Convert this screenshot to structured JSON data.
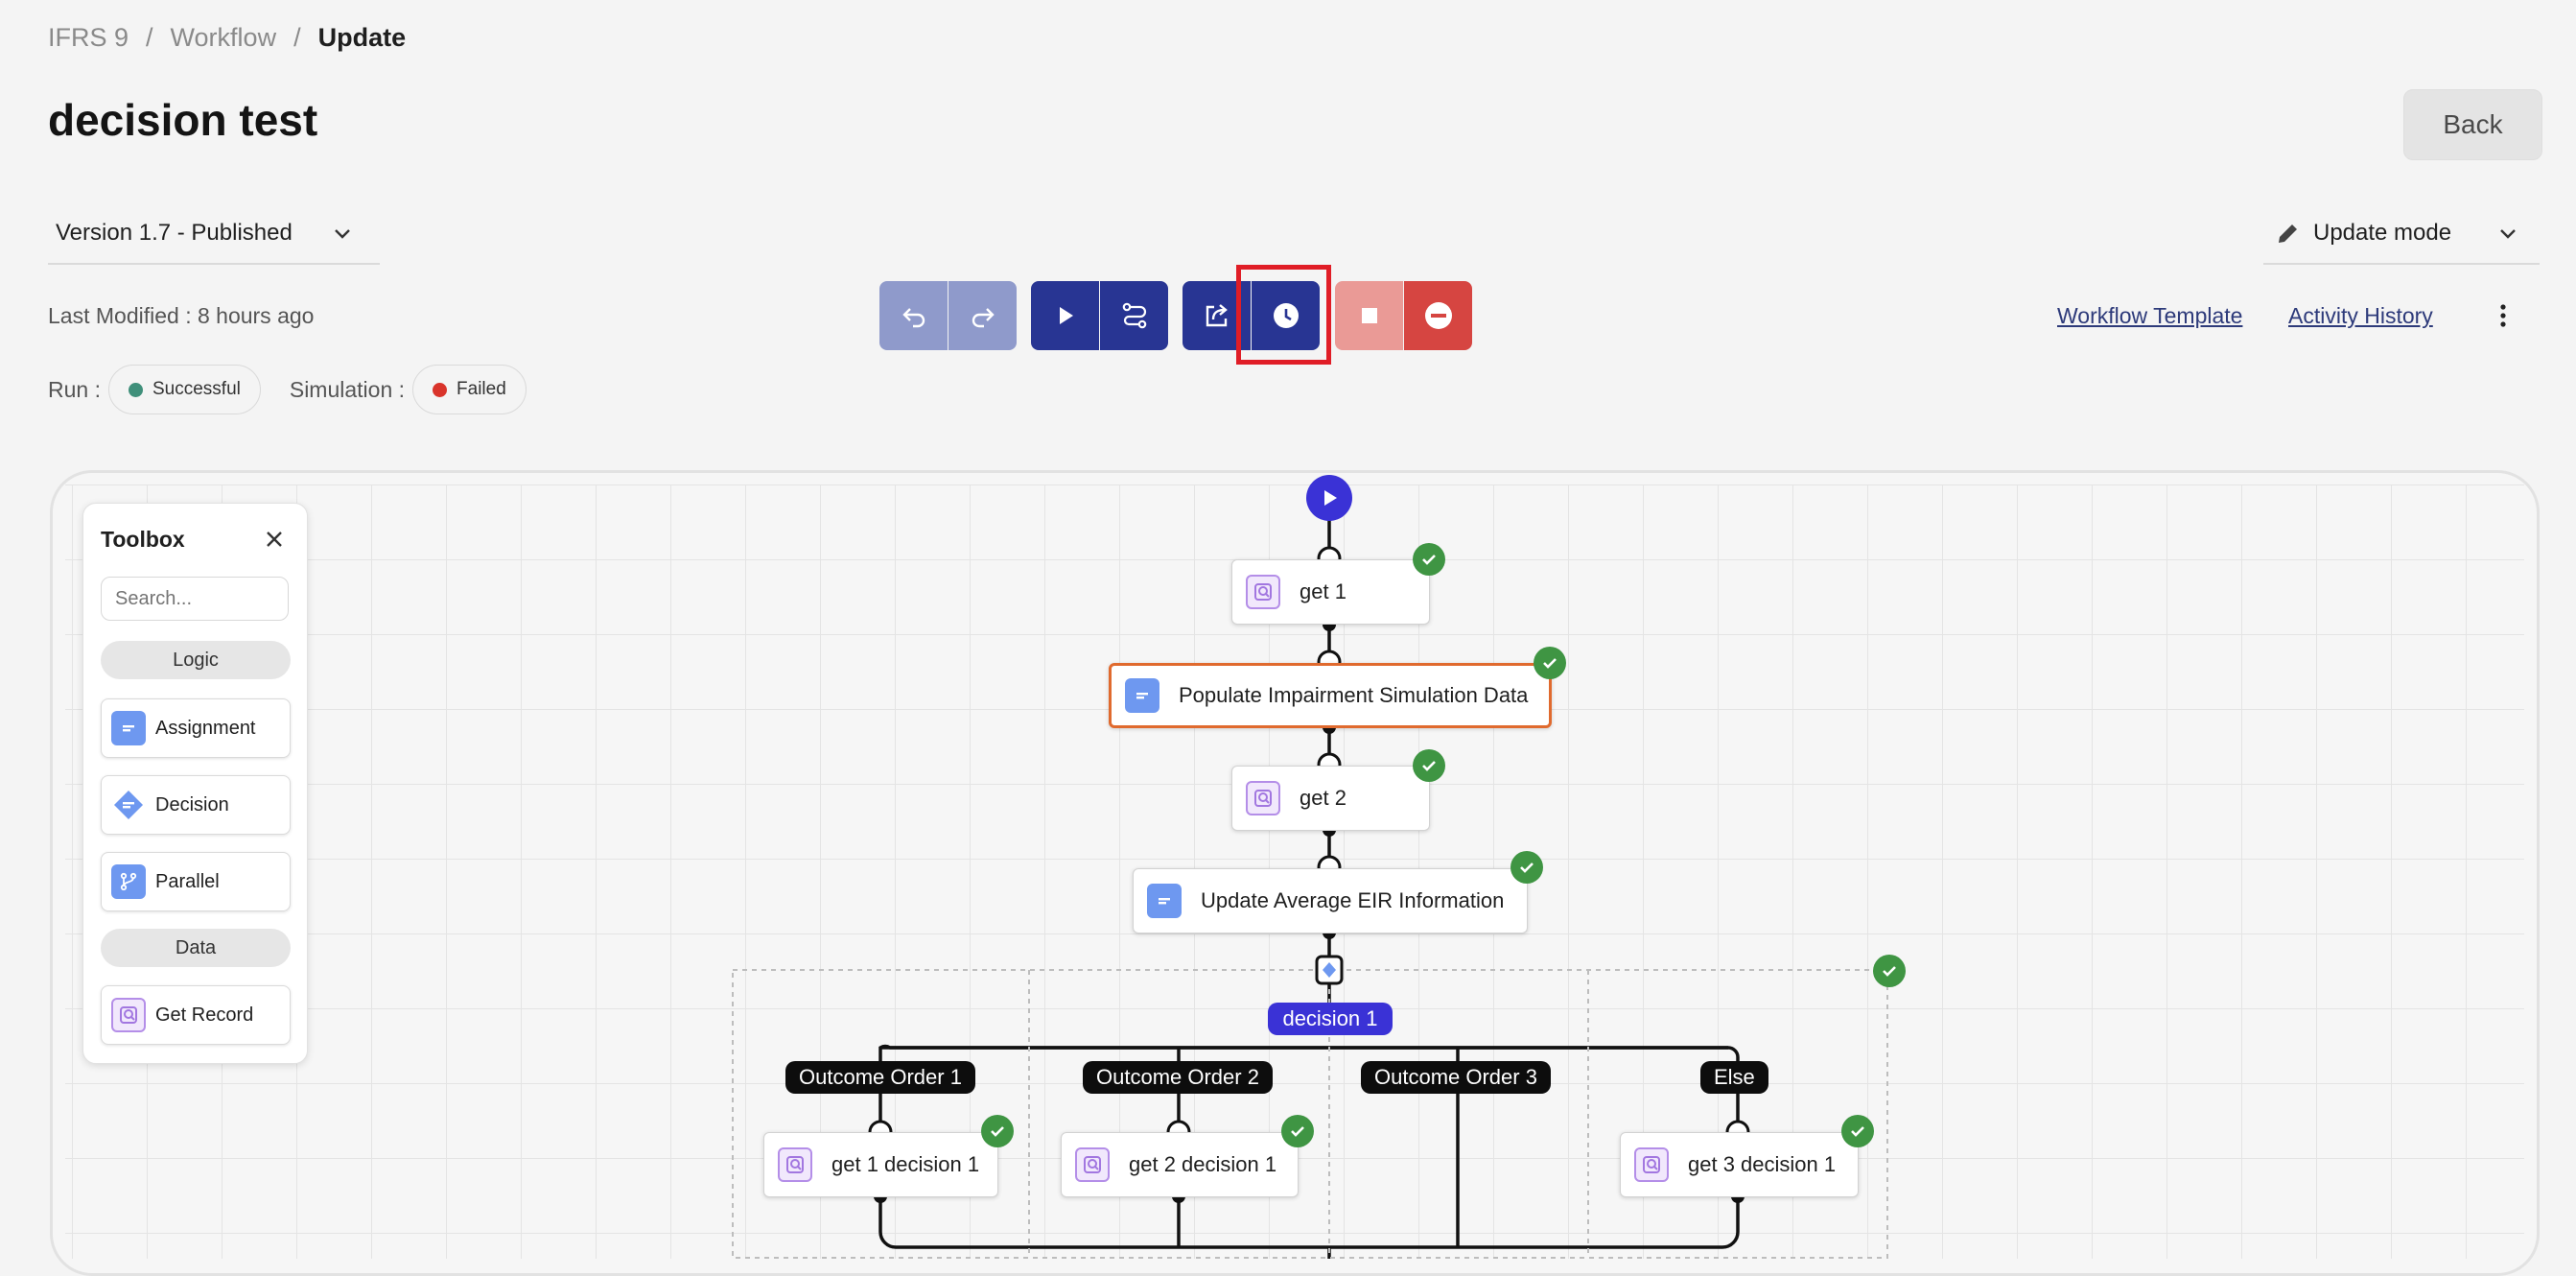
{
  "breadcrumb": {
    "items": [
      "IFRS 9",
      "Workflow",
      "Update"
    ],
    "separator": "/"
  },
  "page_title": "decision test",
  "back_label": "Back",
  "version": {
    "selected": "Version 1.7 - Published"
  },
  "mode": {
    "label": "Update mode"
  },
  "last_modified": "Last Modified : 8 hours ago",
  "run": {
    "label": "Run :",
    "status": "Successful",
    "color": "#3f8f7a"
  },
  "simulation": {
    "label": "Simulation :",
    "status": "Failed",
    "color": "#d9342b"
  },
  "toolbar": {
    "icons": [
      "undo-icon",
      "redo-icon",
      "play-icon",
      "route-icon",
      "export-icon",
      "clock-icon",
      "stop-icon",
      "minus-circle-icon"
    ],
    "colors": {
      "disabled_blue": "#8f9acb",
      "blue": "#283593",
      "disabled_red": "#ea9a96",
      "red": "#d64541",
      "highlight": "#e01d26"
    }
  },
  "links": {
    "workflow_template": "Workflow Template",
    "activity_history": "Activity History"
  },
  "toolbox": {
    "title": "Toolbox",
    "search_placeholder": "Search...",
    "sections": [
      {
        "heading": "Logic",
        "items": [
          "Assignment",
          "Decision",
          "Parallel"
        ]
      },
      {
        "heading": "Data",
        "items": [
          "Get Record"
        ]
      }
    ]
  },
  "flow": {
    "nodes": {
      "get1": "get 1",
      "populate": "Populate Impairment Simulation Data",
      "get2": "get 2",
      "update_eir": "Update Average EIR Information",
      "decision": "decision 1",
      "get1d": "get 1 decision 1",
      "get2d": "get 2 decision 1",
      "get3d": "get 3 decision 1"
    },
    "outcomes": [
      "Outcome Order 1",
      "Outcome Order 2",
      "Outcome Order 3",
      "Else"
    ]
  }
}
